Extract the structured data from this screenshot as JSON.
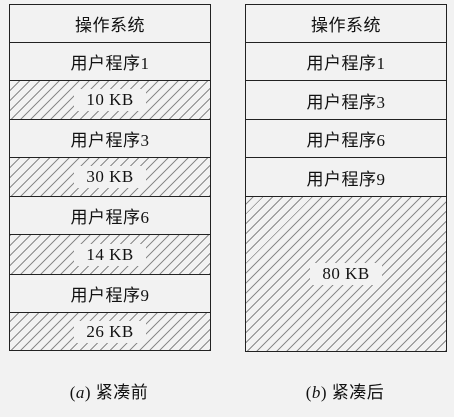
{
  "panel_a": {
    "blocks": [
      {
        "label": "操作系统",
        "type": "os"
      },
      {
        "label": "用户程序1",
        "type": "program"
      },
      {
        "label": "10 KB",
        "type": "free"
      },
      {
        "label": "用户程序3",
        "type": "program"
      },
      {
        "label": "30 KB",
        "type": "free"
      },
      {
        "label": "用户程序6",
        "type": "program"
      },
      {
        "label": "14 KB",
        "type": "free"
      },
      {
        "label": "用户程序9",
        "type": "program"
      },
      {
        "label": "26 KB",
        "type": "free"
      }
    ],
    "caption_prefix": "(",
    "caption_letter": "a",
    "caption_text": ") 紧凑前"
  },
  "panel_b": {
    "blocks": [
      {
        "label": "操作系统",
        "type": "os"
      },
      {
        "label": "用户程序1",
        "type": "program"
      },
      {
        "label": "用户程序3",
        "type": "program"
      },
      {
        "label": "用户程序6",
        "type": "program"
      },
      {
        "label": "用户程序9",
        "type": "program"
      },
      {
        "label": "80 KB",
        "type": "free"
      }
    ],
    "caption_prefix": "(",
    "caption_letter": "b",
    "caption_text": ") 紧凑后"
  },
  "colors": {
    "background": "#f2f2f2",
    "border": "#222222",
    "hatch": "#8a8a8a"
  }
}
